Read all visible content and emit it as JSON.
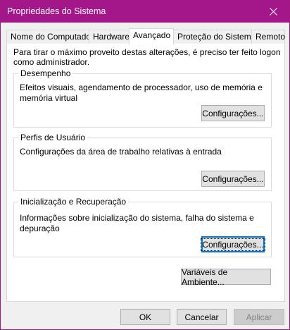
{
  "window": {
    "title": "Propriedades do Sistema"
  },
  "tabs": [
    {
      "label": "Nome do Computador"
    },
    {
      "label": "Hardware"
    },
    {
      "label": "Avançado"
    },
    {
      "label": "Proteção do Sistema"
    },
    {
      "label": "Remoto"
    }
  ],
  "intro": "Para tirar o máximo proveito destas alterações, é preciso ter feito logon como administrador.",
  "groups": {
    "performance": {
      "title": "Desempenho",
      "description": "Efeitos visuais, agendamento de processador, uso de memória e memória virtual",
      "button": "Configurações..."
    },
    "profiles": {
      "title": "Perfis de Usuário",
      "description": "Configurações da área de trabalho relativas à entrada",
      "button": "Configurações..."
    },
    "startup": {
      "title": "Inicialização e Recuperação",
      "description": "Informações sobre inicialização do sistema, falha do sistema e depuração",
      "button": "Configurações..."
    }
  },
  "env_button": "Variáveis de Ambiente...",
  "footer": {
    "ok": "OK",
    "cancel": "Cancelar",
    "apply": "Aplicar"
  },
  "colors": {
    "titlebar": "#a4178a",
    "focus": "#0078d7"
  },
  "icons": {
    "close": "close-icon"
  }
}
